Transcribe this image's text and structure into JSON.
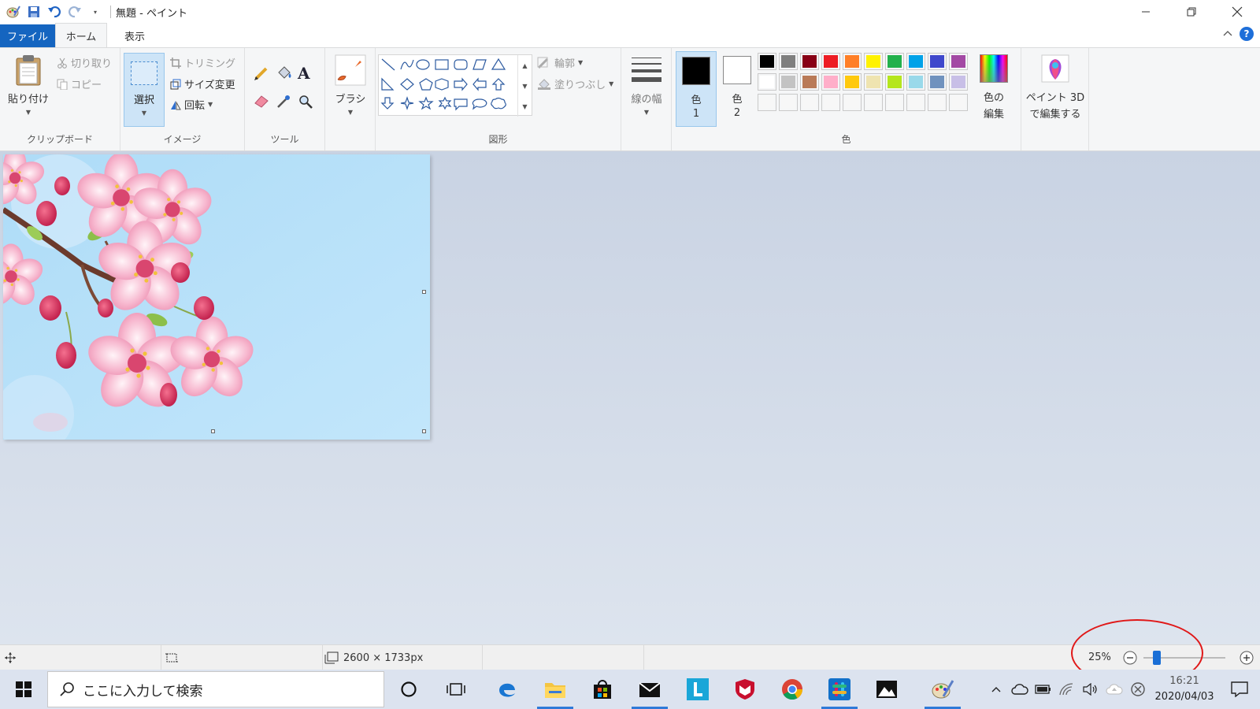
{
  "window": {
    "title": "無題 - ペイント",
    "qat_more": "▾"
  },
  "tabs": {
    "file": "ファイル",
    "home": "ホーム",
    "view": "表示"
  },
  "clipboard": {
    "paste": "貼り付け",
    "cut": "切り取り",
    "copy": "コピー",
    "label": "クリップボード"
  },
  "image": {
    "select": "選択",
    "crop": "トリミング",
    "resize": "サイズ変更",
    "rotate": "回転",
    "label": "イメージ"
  },
  "tools": {
    "label": "ツール"
  },
  "brush": {
    "label": "ブラシ"
  },
  "shapes": {
    "outline": "輪郭",
    "fill": "塗りつぶし",
    "label": "図形"
  },
  "size": {
    "label": "線の幅"
  },
  "colors": {
    "color1_label": "色",
    "color1_num": "1",
    "color2_label": "色",
    "color2_num": "2",
    "color1_value": "#000000",
    "color2_value": "#ffffff",
    "edit_line1": "色の",
    "edit_line2": "編集",
    "label": "色",
    "palette_row1": [
      "#000000",
      "#7f7f7f",
      "#880015",
      "#ed1c24",
      "#ff7f27",
      "#fff200",
      "#22b14c",
      "#00a2e8",
      "#3f48cc",
      "#a349a4"
    ],
    "palette_row2": [
      "#ffffff",
      "#c3c3c3",
      "#b97a57",
      "#ffaec9",
      "#ffc90e",
      "#efe4b0",
      "#b5e61d",
      "#99d9ea",
      "#7092be",
      "#c8bfe7"
    ],
    "palette_row3": [
      "#ffffff",
      "#ffffff",
      "#ffffff",
      "#ffffff",
      "#ffffff",
      "#ffffff",
      "#ffffff",
      "#ffffff",
      "#ffffff",
      "#ffffff"
    ]
  },
  "paint3d": {
    "line1": "ペイント 3D",
    "line2": "で編集する"
  },
  "status": {
    "image_size": "2600 × 1733px",
    "zoom": "25%",
    "zoom_level_percent": 25
  },
  "taskbar": {
    "search_placeholder": "ここに入力して検索",
    "time": "16:21",
    "date": "2020/04/03"
  }
}
